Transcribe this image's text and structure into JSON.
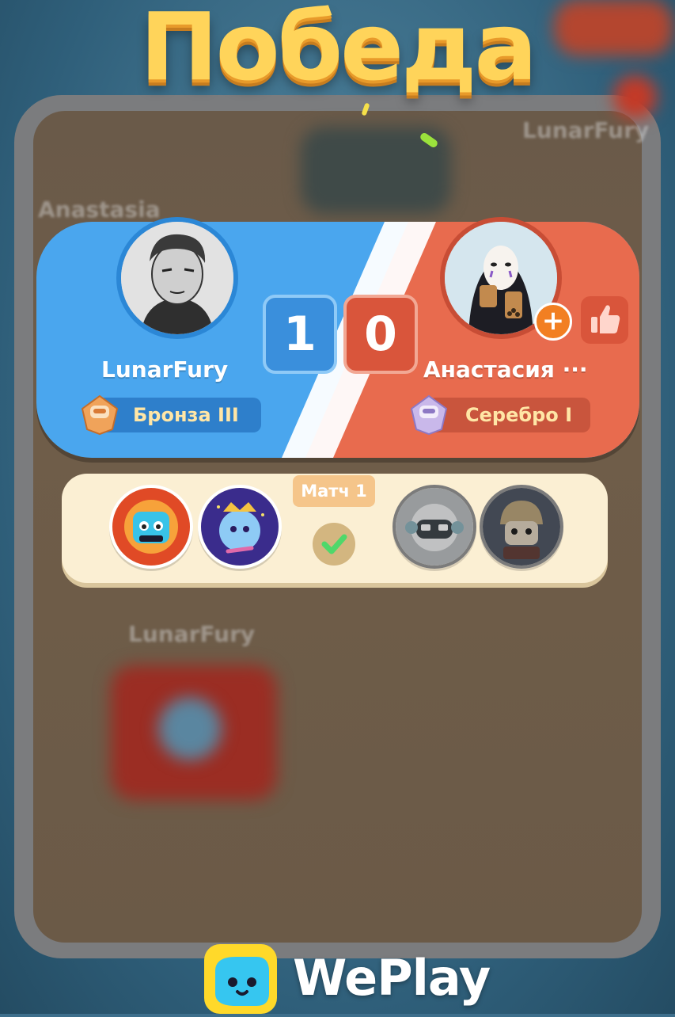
{
  "screen": {
    "title": "Победа"
  },
  "background": {
    "blurred_names": [
      "LunarFury",
      "Anastasia",
      "LunarFury"
    ]
  },
  "scoreboard": {
    "left": {
      "player_name": "LunarFury",
      "score": "1",
      "rank_label": "Бронза III",
      "rank_icon": "bronze-rank-icon",
      "color": "#4aa6ee"
    },
    "right": {
      "player_name": "Анастасия ···",
      "score": "0",
      "rank_label": "Серебро I",
      "rank_icon": "silver-rank-icon",
      "color": "#e86b4e"
    },
    "add_friend_icon": "plus-icon",
    "like_icon": "thumbs-up-icon"
  },
  "match": {
    "label": "Матч 1",
    "result_icon": "check-icon",
    "left_characters": [
      "character-blue-robot",
      "character-purple-star"
    ],
    "right_characters": [
      "character-white-robot",
      "character-knight"
    ]
  },
  "brand": {
    "logo_text": "WePlay"
  }
}
